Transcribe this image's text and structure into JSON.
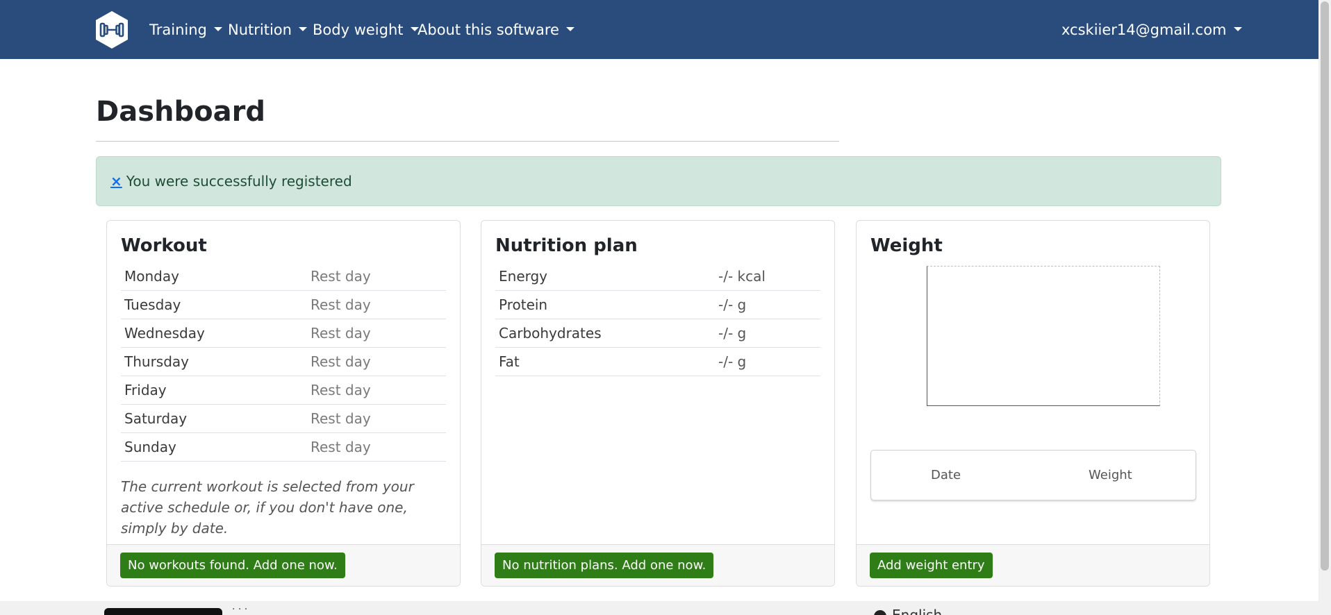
{
  "navbar": {
    "brand_icon": "dumbbell-hexagon-icon",
    "items": [
      {
        "label": "Training"
      },
      {
        "label": "Nutrition"
      },
      {
        "label": "Body weight"
      },
      {
        "label": "About this software"
      }
    ],
    "user": {
      "label": "xcskiier14@gmail.com"
    },
    "color": "#2a4c7d"
  },
  "page": {
    "title": "Dashboard"
  },
  "alert": {
    "close": "×",
    "message": "You were successfully registered",
    "color": "#d1e7dd"
  },
  "workout": {
    "title": "Workout",
    "days": [
      {
        "day": "Monday",
        "status": "Rest day"
      },
      {
        "day": "Tuesday",
        "status": "Rest day"
      },
      {
        "day": "Wednesday",
        "status": "Rest day"
      },
      {
        "day": "Thursday",
        "status": "Rest day"
      },
      {
        "day": "Friday",
        "status": "Rest day"
      },
      {
        "day": "Saturday",
        "status": "Rest day"
      },
      {
        "day": "Sunday",
        "status": "Rest day"
      }
    ],
    "note": "The current workout is selected from your active schedule or, if you don't have one, simply by date.",
    "button": "No workouts found. Add one now."
  },
  "nutrition": {
    "title": "Nutrition plan",
    "rows": [
      {
        "label": "Energy",
        "value": "-/- kcal"
      },
      {
        "label": "Protein",
        "value": "-/- g"
      },
      {
        "label": "Carbohydrates",
        "value": "-/- g"
      },
      {
        "label": "Fat",
        "value": "-/- g"
      }
    ],
    "button": "No nutrition plans. Add one now."
  },
  "weight": {
    "title": "Weight",
    "table_headers": [
      "Date",
      "Weight"
    ],
    "button": "Add weight entry"
  },
  "footer": {
    "language": "English"
  },
  "colors": {
    "success_button": "#2e7d16"
  }
}
